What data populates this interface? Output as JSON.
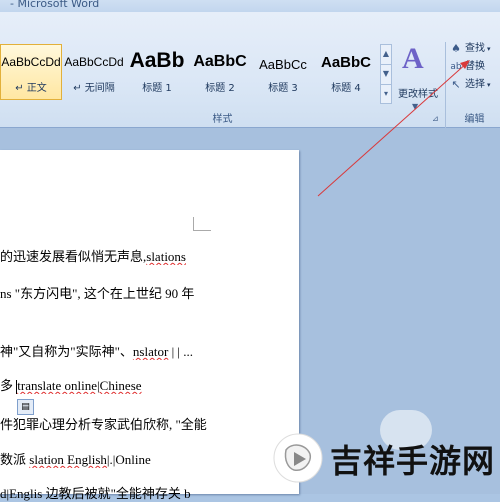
{
  "window": {
    "title": "- Microsoft Word"
  },
  "ribbon": {
    "styles": [
      {
        "sample": "AaBbCcDd",
        "label": "↵ 正文",
        "kind": "normal",
        "selected": true
      },
      {
        "sample": "AaBbCcDd",
        "label": "↵ 无间隔",
        "kind": "normal",
        "selected": false
      },
      {
        "sample": "AaBb",
        "label": "标题 1",
        "kind": "h1",
        "selected": false
      },
      {
        "sample": "AaBbC",
        "label": "标题 2",
        "kind": "h2",
        "selected": false
      },
      {
        "sample": "AaBbCc",
        "label": "标题 3",
        "kind": "h3",
        "selected": false
      },
      {
        "sample": "AaBbC",
        "label": "标题 4",
        "kind": "h4",
        "selected": false
      }
    ],
    "change_styles": {
      "glyph": "A",
      "label": "更改样式"
    },
    "editing": {
      "find": "查找",
      "replace": "替换",
      "select": "选择"
    },
    "group_styles": "样式",
    "group_editing": "编辑"
  },
  "document": {
    "lines": [
      {
        "before": "的迅速发展看似悄无声息,",
        "marked": "slations",
        "after": ""
      },
      {
        "before": "ns \"东方闪电\", 这个在上世纪 90 年",
        "marked": "",
        "after": ""
      },
      {
        "before": "神\"又自称为\"实际神\"、",
        "marked": "nslator",
        "after": " | | ..."
      },
      {
        "before": "多",
        "marked": "",
        "after": "translate online|Chinese",
        "caret": true
      },
      {
        "before": "件犯罪心理分析专家武伯欣称, \"全能",
        "marked": "",
        "after": ""
      },
      {
        "before": "数派 ",
        "marked": "slation English",
        "after": "|.|Online"
      },
      {
        "before": "d|Englis 边教后被就\"全能神存关 b",
        "marked": "",
        "after": ""
      }
    ]
  },
  "watermark": {
    "text": "吉祥手游网"
  },
  "colors": {
    "arrow": "#d9393b",
    "ribbon": "#dbe7f6",
    "selected_tile": "#ffe7a2"
  }
}
